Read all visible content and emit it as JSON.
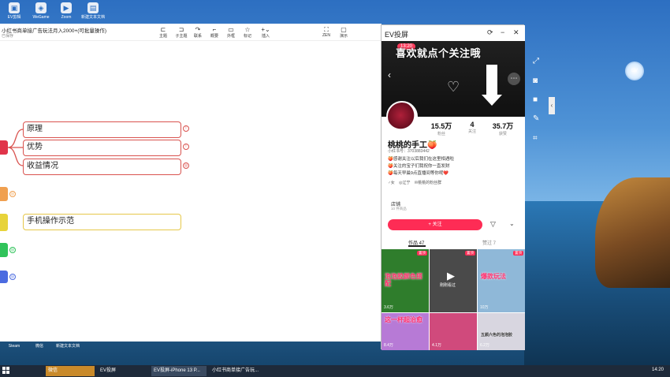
{
  "desktop": {
    "icons_top": [
      {
        "label": "EV剪辑",
        "icon": "app-icon"
      },
      {
        "label": "WeGame",
        "icon": "game-icon"
      },
      {
        "label": "Zoom",
        "icon": "video-icon"
      },
      {
        "label": "新建文本文档",
        "icon": "text-file-icon"
      }
    ],
    "icons_bottom": [
      {
        "label": "Steam",
        "icon": "steam-icon"
      },
      {
        "label": "微信",
        "icon": "wechat-icon"
      },
      {
        "label": "新建文本文档",
        "icon": "text-file-icon"
      }
    ]
  },
  "mindmap": {
    "title": "小红书商单接广告玩法月入2000+(可批量操作)",
    "subtitle": "已保存",
    "toolbar": [
      {
        "label": "主题",
        "icon": "topic-icon"
      },
      {
        "label": "子主题",
        "icon": "subtopic-icon"
      },
      {
        "label": "联系",
        "icon": "link-icon"
      },
      {
        "label": "概要",
        "icon": "summary-icon"
      },
      {
        "label": "外框",
        "icon": "frame-icon"
      },
      {
        "label": "标记",
        "icon": "star-icon"
      },
      {
        "label": "插入",
        "icon": "plus-icon"
      },
      {
        "label": "ZEN",
        "icon": "zen-icon"
      },
      {
        "label": "演示",
        "icon": "present-icon"
      }
    ],
    "nodes": [
      "原理",
      "优势",
      "收益情况",
      "手机操作示范"
    ]
  },
  "ev": {
    "title": "EV投屏",
    "banner_text": "喜欢就点个关注哦",
    "time": "13:20",
    "stats": [
      {
        "num": "15.5万",
        "label": "粉丝"
      },
      {
        "num": "4",
        "label": "关注"
      },
      {
        "num": "35.7万",
        "label": "获赞"
      }
    ],
    "name": "桃桃的手工🍑",
    "rednote_id": "小红书号：3703883442",
    "bio": [
      "🍑感谢关注以后我们在这里相遇啦",
      "🍑关注的宝子们我祝你一直发财",
      "🍑每天早晨9点直播间等你呢❤️"
    ],
    "tags": [
      "♂女",
      "◎辽宁",
      "✉桃桃的粉丝群"
    ],
    "shop": "店铺",
    "shop_sub": "10 件商品",
    "follow": "+ 关注",
    "tab_works": "作品 47",
    "tab_collect": "赞过 7",
    "cells": [
      {
        "tag": "置顶",
        "text": "泡泡胶颜色搭配",
        "views": "3.6万",
        "bg": "#2f7d2c"
      },
      {
        "tag": "置顶",
        "text": "",
        "views": "",
        "bg": "#4a4a4a",
        "overlay": "刚刚看过"
      },
      {
        "tag": "置顶",
        "text": "爆款玩法",
        "views": "10万",
        "bg": "#8fb8d8"
      },
      {
        "tag": "",
        "text": "这一杯超治愈",
        "views": "8.4万",
        "bg": "#b77ad6"
      },
      {
        "tag": "",
        "text": "",
        "views": "4.1万",
        "bg": "#d04a7c"
      },
      {
        "tag": "",
        "text": "五颜六色的泡泡胶",
        "views": "6.2万",
        "bg": "#d8d6e0"
      }
    ]
  },
  "taskbar": {
    "items": [
      "微信",
      "EV投屏",
      "EV投屏-iPhone 13 P...",
      "小红书商单接广告玩..."
    ],
    "time": "14:20"
  }
}
